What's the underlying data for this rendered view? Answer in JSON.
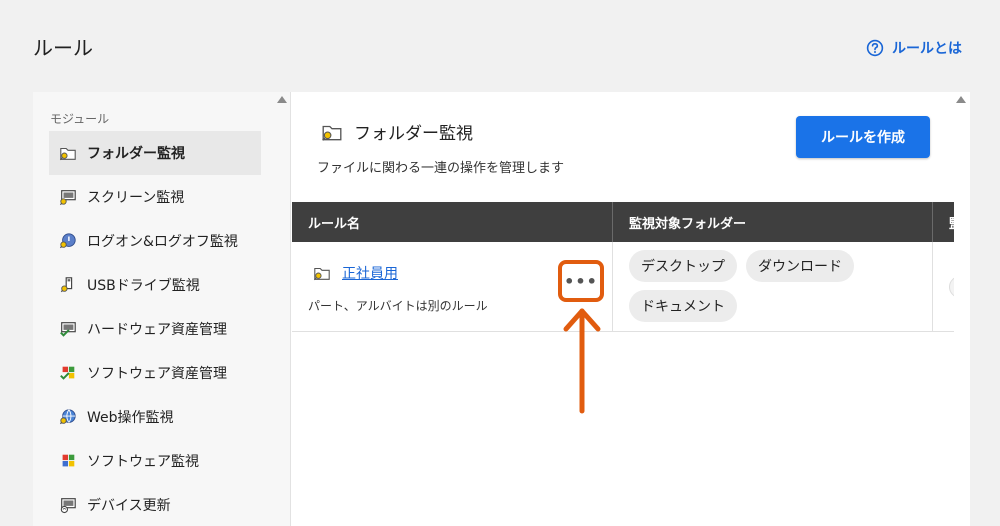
{
  "page": {
    "title": "ルール",
    "help_link": "ルールとは"
  },
  "sidebar": {
    "section_label": "モジュール",
    "items": [
      {
        "label": "フォルダー監視",
        "icon": "folder-search-icon",
        "active": true
      },
      {
        "label": "スクリーン監視",
        "icon": "screen-search-icon",
        "active": false
      },
      {
        "label": "ログオン&ログオフ監視",
        "icon": "logon-search-icon",
        "active": false
      },
      {
        "label": "USBドライブ監視",
        "icon": "usb-search-icon",
        "active": false
      },
      {
        "label": "ハードウェア資産管理",
        "icon": "hardware-check-icon",
        "active": false
      },
      {
        "label": "ソフトウェア資産管理",
        "icon": "software-check-icon",
        "active": false
      },
      {
        "label": "Web操作監視",
        "icon": "web-search-icon",
        "active": false
      },
      {
        "label": "ソフトウェア監視",
        "icon": "software-search-icon",
        "active": false
      },
      {
        "label": "デバイス更新",
        "icon": "device-update-icon",
        "active": false
      }
    ]
  },
  "main": {
    "title": "フォルダー監視",
    "description": "ファイルに関わる一連の操作を管理します",
    "create_button": "ルールを作成",
    "table": {
      "headers": [
        "ルール名",
        "監視対象フォルダー",
        "監"
      ],
      "rows": [
        {
          "name": "正社員用",
          "note": "パート、アルバイトは別のルール",
          "more": "•••",
          "folders": [
            "デスクトップ",
            "ダウンロード",
            "ドキュメント"
          ]
        }
      ]
    }
  },
  "colors": {
    "accent": "#1a73e8",
    "link": "#1a66d6",
    "highlight": "#e15c0f",
    "header_bg": "#3f3f3f"
  }
}
